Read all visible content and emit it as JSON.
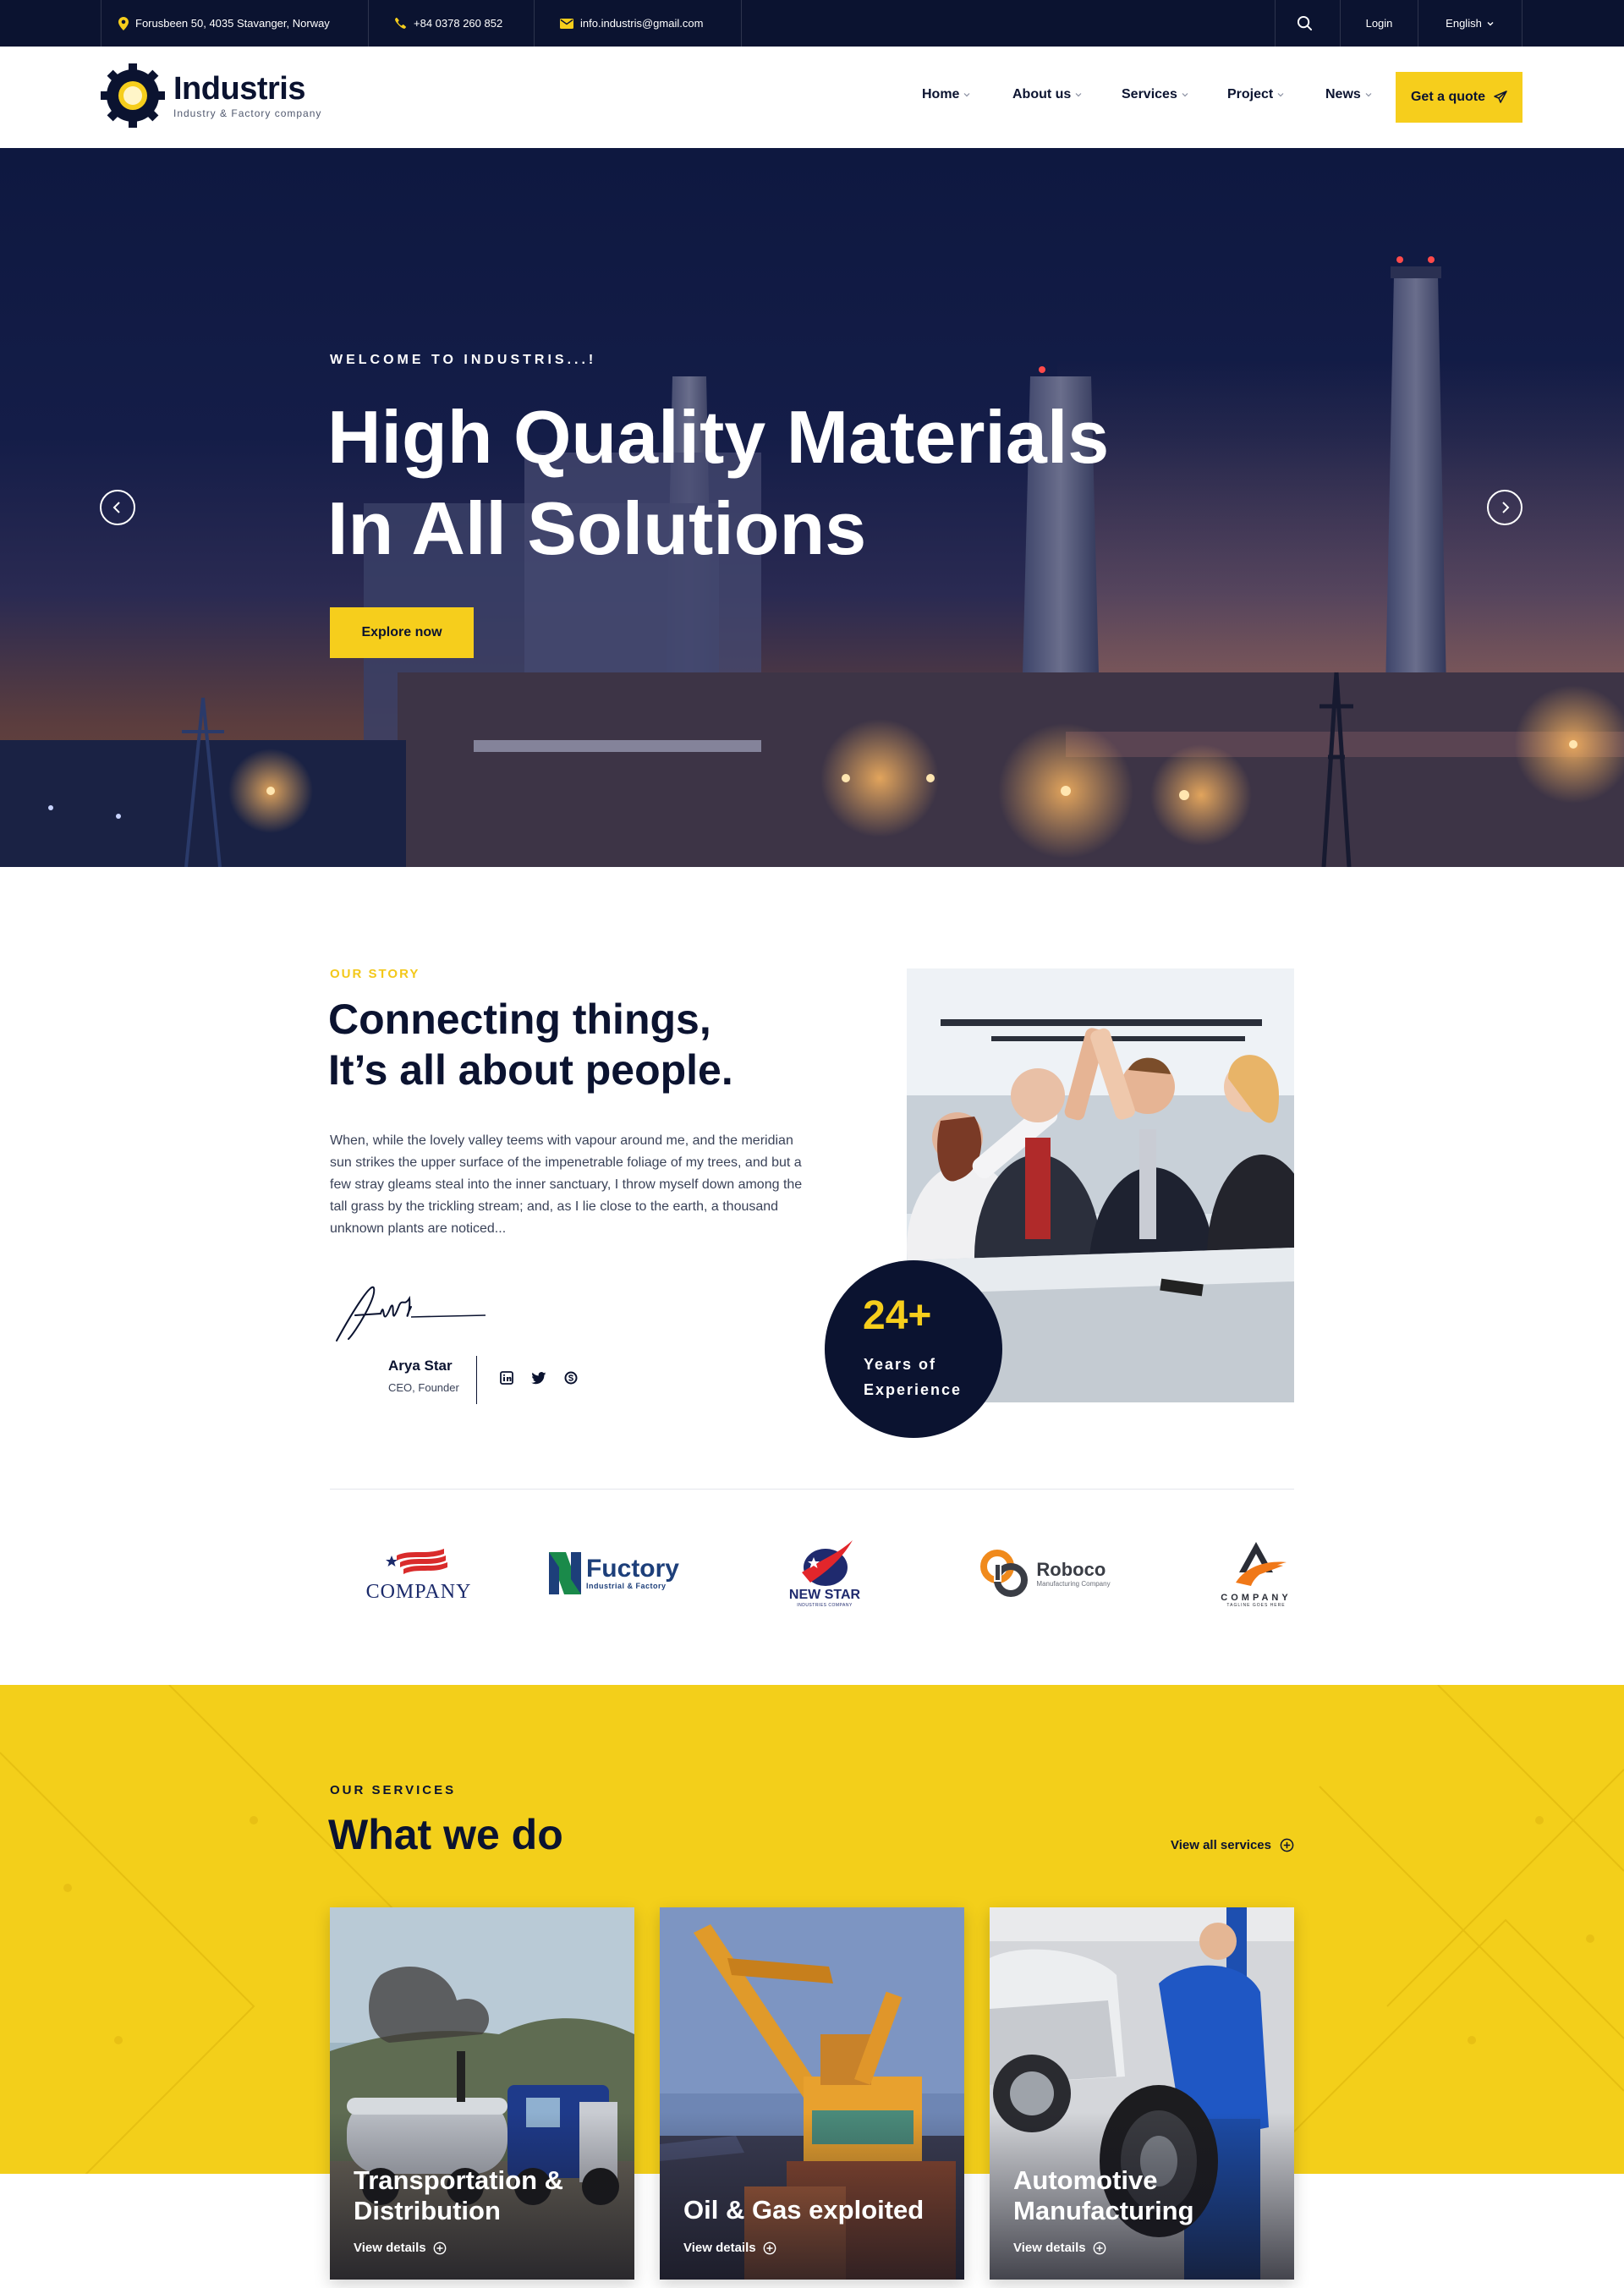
{
  "topbar": {
    "address": "Forusbeen 50, 4035 Stavanger, Norway",
    "phone": "+84 0378 260 852",
    "email": "info.industris@gmail.com",
    "login": "Login",
    "language": "English"
  },
  "header": {
    "logo_name": "Industris",
    "logo_tagline": "Industry & Factory company",
    "nav": [
      {
        "label": "Home"
      },
      {
        "label": "About us"
      },
      {
        "label": "Services"
      },
      {
        "label": "Project"
      },
      {
        "label": "News"
      }
    ],
    "quote_label": "Get a quote"
  },
  "hero": {
    "eyebrow": "WELCOME TO INDUSTRIS...!",
    "title_line1": "High Quality Materials",
    "title_line2": "In All Solutions",
    "cta": "Explore now"
  },
  "story": {
    "eyebrow": "OUR STORY",
    "title_line1": "Connecting things,",
    "title_line2": "It’s all about people.",
    "text": "When, while the lovely valley teems with vapour around me, and the meridian sun strikes the upper surface of the impenetrable foliage of my trees, and but a few stray gleams steal into the inner sanctuary, I throw myself down among the tall grass by the trickling stream; and, as I lie close to the earth, a thousand unknown plants are noticed...",
    "founder_name": "Arya Star",
    "founder_role": "CEO, Founder",
    "badge_number": "24+",
    "badge_label": "Years of Experience"
  },
  "brands": [
    {
      "name": "COMPANY",
      "icon": "flag-star-logo"
    },
    {
      "name": "Fuctory",
      "sub": "Industrial & Factory",
      "icon": "leaf-n-logo"
    },
    {
      "name": "NEW STAR",
      "sub": "INDUSTRIES COMPANY",
      "icon": "swoosh-star-logo"
    },
    {
      "name": "Roboco",
      "sub": "Manufacturing Company",
      "icon": "rings-logo"
    },
    {
      "name": "COMPANY",
      "sub": "TAGLINE GOES HERE",
      "icon": "triangle-swoosh-logo"
    }
  ],
  "services": {
    "eyebrow": "OUR SERVICES",
    "title": "What we do",
    "view_all": "View all services",
    "cards": [
      {
        "title": "Transportation & Distribution",
        "link": "View details"
      },
      {
        "title": "Oil & Gas exploited",
        "link": "View details"
      },
      {
        "title": "Automotive Manufacturing",
        "link": "View details"
      }
    ]
  },
  "colors": {
    "navy": "#0b1330",
    "accent_yellow": "#f6ce1c",
    "white": "#ffffff"
  }
}
